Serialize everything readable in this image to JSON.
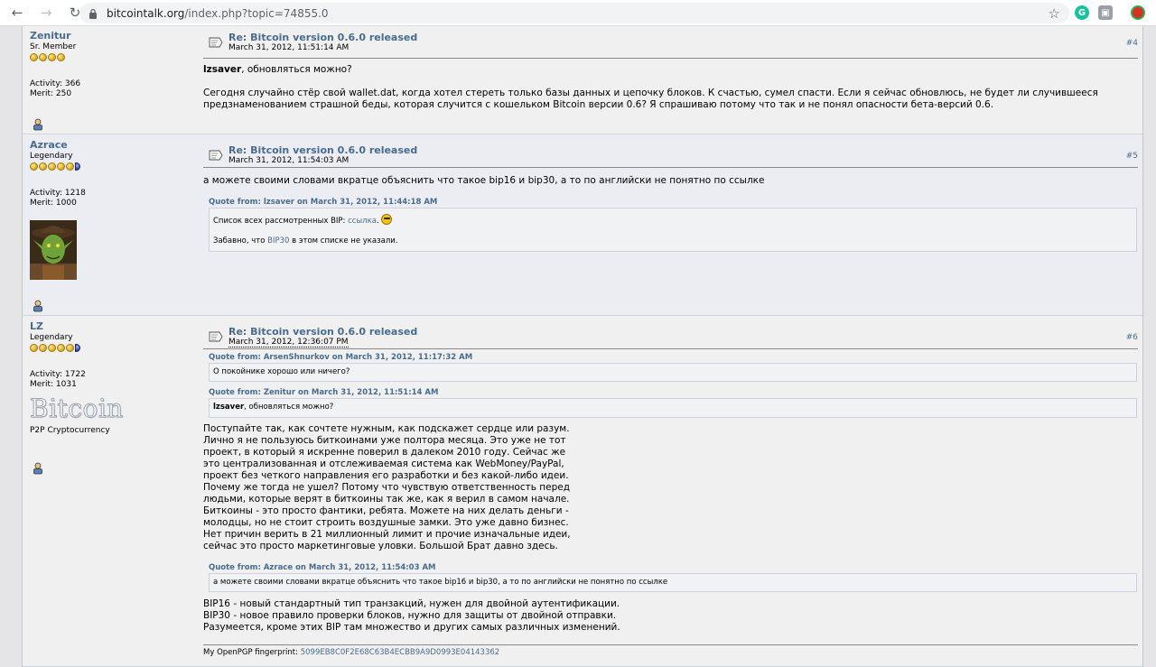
{
  "browser": {
    "url_host": "bitcointalk.org",
    "url_path": "/index.php?topic=74855.0"
  },
  "posts": [
    {
      "author": "Zenitur",
      "rank": "Sr. Member",
      "activity": "Activity: 366",
      "merit": "Merit: 250",
      "subject": "Re: Bitcoin version 0.6.0 released",
      "date": "March 31, 2012, 11:51:14 AM",
      "number": "#4",
      "mention": "lzsaver",
      "mention_rest": ", обновляться можно?",
      "body": "Сегодня случайно стёр свой wallet.dat, когда хотел стереть только базы данных и цепочку блоков. К счастью, сумел спасти. Если я сейчас обновлюсь, не будет ли случившееся предзнаменованием страшной беды, которая случится с кошельком Bitcoin версии 0.6? Я спрашиваю потому что так и не понял опасности бета-версий 0.6."
    },
    {
      "author": "Azrace",
      "rank": "Legendary",
      "activity": "Activity: 1218",
      "merit": "Merit: 1000",
      "subject": "Re: Bitcoin version 0.6.0 released",
      "date": "March 31, 2012, 11:54:03 AM",
      "number": "#5",
      "body": "а можете своими словами вкратце объяснить что такое bip16 и bip30, а то по английски не понятно по ссылке",
      "quote_head": "Quote from: lzsaver on March 31, 2012, 11:44:18 AM",
      "quote_line1_text": "Список всех рассмотренных BIP: ",
      "quote_line1_link": "ссылка",
      "quote_line1_end": ".",
      "quote_line2_start": "Забавно, что ",
      "quote_line2_link": "BIP30",
      "quote_line2_end": " в этом списке не указали."
    },
    {
      "author": "LZ",
      "rank": "Legendary",
      "activity": "Activity: 1722",
      "merit": "Merit: 1031",
      "personal_brand": "Bitcoin",
      "personal_text": "P2P Cryptocurrency",
      "subject": "Re: Bitcoin version 0.6.0 released",
      "date": "March 31, 2012, 12:36:07 PM",
      "number": "#6",
      "quote1_head": "Quote from: ArsenShnurkov on March 31, 2012, 11:17:32 AM",
      "quote1_body": "О покойнике хорошо или ничего?",
      "quote2_head": "Quote from: Zenitur on March 31, 2012, 11:51:14 AM",
      "quote2_mention": "lzsaver",
      "quote2_rest": ", обновляться можно?",
      "body_lines": [
        "Поступайте так, как сочтете нужным, как подскажет сердце или разум.",
        "Лично я не пользуюсь биткоинами уже полтора месяца. Это уже не тот",
        "проект, в который я искренне поверил в далеком 2010 году. Сейчас же",
        "это централизованная и отслеживаемая система как WebMoney/PayPal,",
        "проект без четкого направления его разработки и без какой-либо идеи.",
        "Почему же тогда не ушел? Потому что чувствую ответственность перед",
        "людьми, которые верят в биткоины так же, как я верил в самом начале.",
        "Биткоины - это просто фантики, ребята. Можете на них делать деньги -",
        "молодцы, но не стоит строить воздушные замки. Это уже давно бизнес.",
        "Нет причин верить в 21 миллионный лимит и прочие изначальные идеи,",
        "сейчас это просто маркетинговые уловки. Большой Брат давно здесь."
      ],
      "quote3_head": "Quote from: Azrace on March 31, 2012, 11:54:03 AM",
      "quote3_body": "а можете своими словами вкратце объяснить что такое bip16 и bip30, а то по английски не понятно по ссылке",
      "tail_lines": [
        "BIP16 - новый стандартный тип транзакций, нужен для двойной аутентификации.",
        "BIP30 - новое правило проверки блоков, нужно для защиты от двойной отправки.",
        "Разумеется, кроме этих BIP там множество и других самых различных изменений."
      ],
      "sig_label": "My OpenPGP fingerprint: ",
      "sig_fingerprint": "5099EB8C0F2E68C63B4ECBB9A9D0993E04143362"
    }
  ]
}
